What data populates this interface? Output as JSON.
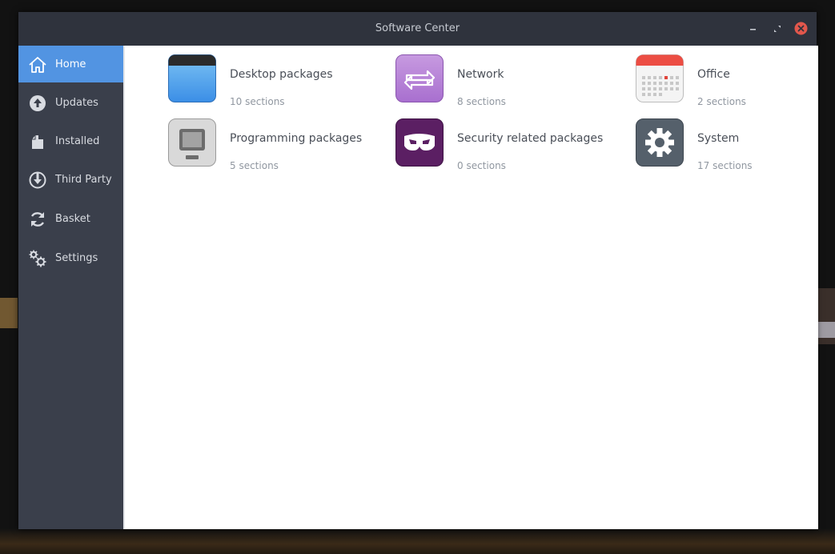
{
  "window": {
    "title": "Software Center"
  },
  "sidebar": {
    "items": [
      {
        "label": "Home",
        "icon": "home-icon",
        "active": true
      },
      {
        "label": "Updates",
        "icon": "arrow-up-circle-icon",
        "active": false
      },
      {
        "label": "Installed",
        "icon": "package-icon",
        "active": false
      },
      {
        "label": "Third Party",
        "icon": "download-icon",
        "active": false
      },
      {
        "label": "Basket",
        "icon": "sync-icon",
        "active": false
      },
      {
        "label": "Settings",
        "icon": "gears-icon",
        "active": false
      }
    ]
  },
  "categories": [
    {
      "name": "Desktop packages",
      "count": "10 sections",
      "icon": "desktop-window-icon"
    },
    {
      "name": "Network",
      "count": "8 sections",
      "icon": "network-arrows-icon"
    },
    {
      "name": "Office",
      "count": "2 sections",
      "icon": "calendar-icon"
    },
    {
      "name": "Programming packages",
      "count": "5 sections",
      "icon": "monitor-icon"
    },
    {
      "name": "Security related packages",
      "count": "0 sections",
      "icon": "mask-icon"
    },
    {
      "name": "System",
      "count": "17 sections",
      "icon": "gear-icon"
    }
  ],
  "colors": {
    "accent": "#5294e2",
    "sidebar": "#3a3f4b",
    "titlebar": "#2f333d",
    "close": "#e2574c"
  }
}
